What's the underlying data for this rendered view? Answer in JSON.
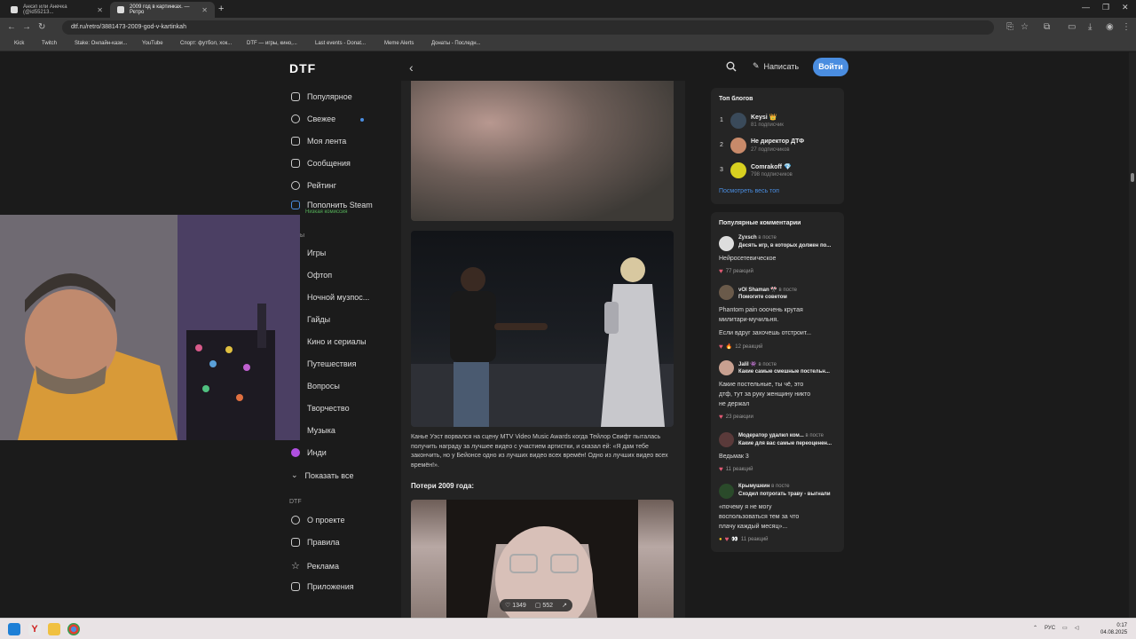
{
  "browser": {
    "tabs": [
      {
        "title": "Анкэп или Анечка (@id55213...",
        "active": false
      },
      {
        "title": "2009 год в картинках. — Ретро",
        "active": true
      }
    ],
    "url": "dtf.ru/retro/3881473-2009-god-v-kartinkah",
    "bookmarks": [
      {
        "label": "Kick",
        "color": "#53fc18"
      },
      {
        "label": "Twitch",
        "color": "#9146ff"
      },
      {
        "label": "Stake: Онлайн-кази...",
        "color": "#cccccc"
      },
      {
        "label": "YouTube",
        "color": "#ff0000"
      },
      {
        "label": "Спорт: футбол, хок...",
        "color": "#e53935"
      },
      {
        "label": "DTF — игры, кино,...",
        "color": "#ffffff"
      },
      {
        "label": "Last events - Donat...",
        "color": "#cccccc"
      },
      {
        "label": "Meme Alerts",
        "color": "#f5a623"
      },
      {
        "label": "Донаты - Последн...",
        "color": "#f58220"
      }
    ]
  },
  "site": {
    "logo": "DTF",
    "header": {
      "write_label": "Написать",
      "login_label": "Войти"
    },
    "nav": [
      {
        "label": "Популярное",
        "icon": "fire-icon"
      },
      {
        "label": "Свежее",
        "icon": "clock-icon"
      },
      {
        "label": "Моя лента",
        "icon": "feed-icon"
      },
      {
        "label": "Сообщения",
        "icon": "chat-icon"
      },
      {
        "label": "Рейтинг",
        "icon": "rating-icon"
      },
      {
        "label": "Пополнить Steam",
        "icon": "steam-icon",
        "sub": "Низкая комиссия"
      }
    ],
    "categories_header": "ы",
    "categories": [
      {
        "label": "Игры",
        "color": "#5aa0ff"
      },
      {
        "label": "Офтоп",
        "color": "#e0306a"
      },
      {
        "label": "Ночной музпос...",
        "color": "#9b6bff"
      },
      {
        "label": "Гайды",
        "color": "#f0a020"
      },
      {
        "label": "Кино и сериалы",
        "color": "#ff5a36"
      },
      {
        "label": "Путешествия",
        "color": "#3ab0e0"
      },
      {
        "label": "Вопросы",
        "color": "#40c080"
      },
      {
        "label": "Творчество",
        "color": "#e060b0"
      },
      {
        "label": "Музыка",
        "color": "#8a8aff"
      },
      {
        "label": "Инди",
        "color": "#b050e0"
      }
    ],
    "show_all": "Показать все",
    "dtf_section": "DTF",
    "footer_nav": [
      {
        "label": "О проекте",
        "icon": "info-icon"
      },
      {
        "label": "Правила",
        "icon": "rules-icon"
      },
      {
        "label": "Реклама",
        "icon": "star-icon"
      },
      {
        "label": "Приложения",
        "icon": "apps-icon"
      }
    ]
  },
  "article": {
    "caption": "Канье Уэст ворвался на сцену MTV Video Music Awards когда Тейлор Свифт пыталась получить награду за лучшее видео с участием артистки, и сказал ей: «Я дам тебе закончить, но у Бейонсе одно из лучших видео всех времён! Одно из лучших видео всех времён!».",
    "losses_heading": "Потери 2009 года:",
    "likes": "1349",
    "comments": "552"
  },
  "top_blogs": {
    "title": "Топ блогов",
    "items": [
      {
        "rank": "1",
        "name": "Keysi 👑",
        "subs": "81 подписчик",
        "color": "#3a4a5a"
      },
      {
        "rank": "2",
        "name": "Не директор ДТФ",
        "subs": "27 подписчиков",
        "color": "#c88a6a"
      },
      {
        "rank": "3",
        "name": "Comrakoff 💎",
        "subs": "798 подписчиков",
        "color": "#d8d020"
      }
    ],
    "see_all": "Посмотреть весь топ"
  },
  "popular_comments": {
    "title": "Популярные комментарии",
    "items": [
      {
        "author": "Zyxsch",
        "where": "в посте",
        "post": "Десять игр, в которых должен по...",
        "lines": [
          "Нейросетевическое"
        ],
        "reactions": "77 реакций",
        "color": "#ddd"
      },
      {
        "author": "vOl Shaman 🎌",
        "where": "в посте",
        "post": "Помогите советом",
        "lines": [
          "Phantom pain ооочень крутая",
          "милитари-мучильня.",
          "Если вдруг захочешь отстроит..."
        ],
        "reactions": "12 реакций",
        "color": "#6a5a4a"
      },
      {
        "author": "Jalil 👾",
        "where": "в посте",
        "post": "Какие самые смешные постельн...",
        "lines": [
          "Какие постельные, ты чё, это",
          "дтф, тут за руку женщину никто",
          "не держал"
        ],
        "reactions": "23 реакции",
        "color": "#c8a090"
      },
      {
        "author": "Модератор удалил ком...",
        "where": "в посте",
        "post": "Какие для вас самые переоценен...",
        "lines": [
          "Ведьмак 3"
        ],
        "reactions": "11 реакций",
        "color": "#5a3a3a"
      },
      {
        "author": "Крымушкин",
        "where": "в посте",
        "post": "Сходил потрогать траву - выгнали",
        "lines": [
          "«почему я не могу",
          "воспользоваться тем за что",
          "плачу каждый месяц»..."
        ],
        "reactions": "11 реакций",
        "color": "#2a4a2a"
      }
    ]
  },
  "taskbar": {
    "lang": "РУС",
    "time": "0:17",
    "date": "04.08.2025"
  }
}
